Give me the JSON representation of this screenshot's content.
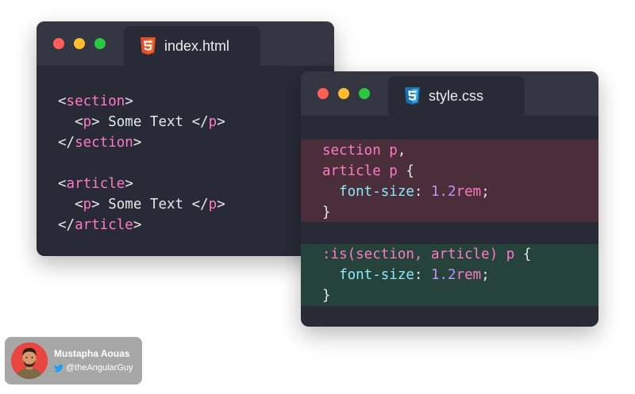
{
  "html_window": {
    "tab_label": "index.html",
    "tab_icon": "html5-icon",
    "lines": [
      [
        {
          "t": "<",
          "c": "punc"
        },
        {
          "t": "section",
          "c": "tag"
        },
        {
          "t": ">",
          "c": "punc"
        }
      ],
      [
        {
          "t": "  <",
          "c": "punc"
        },
        {
          "t": "p",
          "c": "tag"
        },
        {
          "t": "> Some Text </",
          "c": "punc"
        },
        {
          "t": "p",
          "c": "tag"
        },
        {
          "t": ">",
          "c": "punc"
        }
      ],
      [
        {
          "t": "</",
          "c": "punc"
        },
        {
          "t": "section",
          "c": "tag"
        },
        {
          "t": ">",
          "c": "punc"
        }
      ],
      [],
      [
        {
          "t": "<",
          "c": "punc"
        },
        {
          "t": "article",
          "c": "tag"
        },
        {
          "t": ">",
          "c": "punc"
        }
      ],
      [
        {
          "t": "  <",
          "c": "punc"
        },
        {
          "t": "p",
          "c": "tag"
        },
        {
          "t": "> Some Text </",
          "c": "punc"
        },
        {
          "t": "p",
          "c": "tag"
        },
        {
          "t": ">",
          "c": "punc"
        }
      ],
      [
        {
          "t": "</",
          "c": "punc"
        },
        {
          "t": "article",
          "c": "tag"
        },
        {
          "t": ">",
          "c": "punc"
        }
      ]
    ]
  },
  "css_window": {
    "tab_label": "style.css",
    "tab_icon": "css3-icon",
    "old_block": [
      [
        {
          "t": "section p",
          "c": "sel"
        },
        {
          "t": ",",
          "c": "punc"
        }
      ],
      [
        {
          "t": "article p",
          "c": "sel"
        },
        {
          "t": " {",
          "c": "punc"
        }
      ],
      [
        {
          "t": "  font-size",
          "c": "prop"
        },
        {
          "t": ": ",
          "c": "punc"
        },
        {
          "t": "1.2",
          "c": "num"
        },
        {
          "t": "rem",
          "c": "unit"
        },
        {
          "t": ";",
          "c": "punc"
        }
      ],
      [
        {
          "t": "}",
          "c": "punc"
        }
      ]
    ],
    "new_block": [
      [
        {
          "t": ":is(section, article) p",
          "c": "sel"
        },
        {
          "t": " {",
          "c": "punc"
        }
      ],
      [
        {
          "t": "  font-size",
          "c": "prop"
        },
        {
          "t": ": ",
          "c": "punc"
        },
        {
          "t": "1.2",
          "c": "num"
        },
        {
          "t": "rem",
          "c": "unit"
        },
        {
          "t": ";",
          "c": "punc"
        }
      ],
      [
        {
          "t": "}",
          "c": "punc"
        }
      ]
    ]
  },
  "colors": {
    "editor_bg": "#282a36",
    "old_block_bg": "#4a2e3a",
    "new_block_bg": "#25433b",
    "tag": "#ff79c6",
    "property": "#8be9fd",
    "number": "#bd93f9"
  },
  "author": {
    "name": "Mustapha Aouas",
    "handle": "@theAngularGuy",
    "handle_icon": "twitter-bird-icon"
  }
}
